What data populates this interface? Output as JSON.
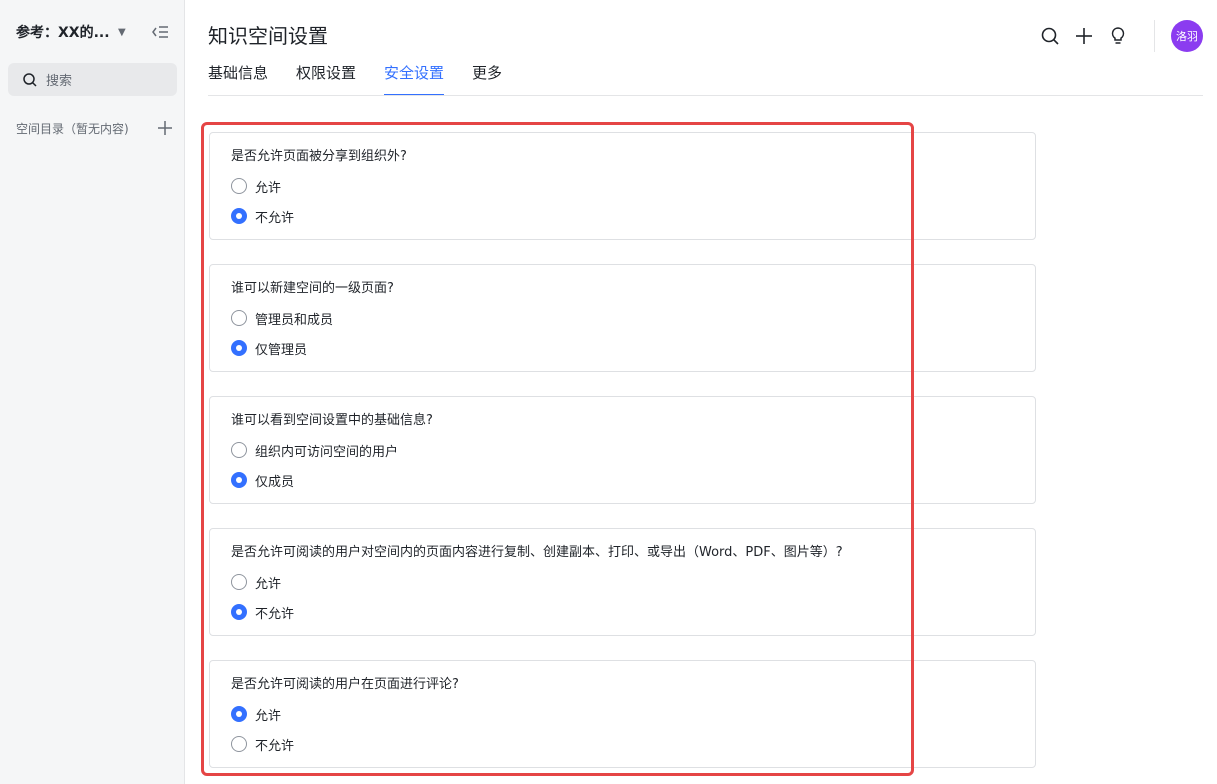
{
  "sidebar": {
    "space_name": "参考：XX的...",
    "search_placeholder": "搜索",
    "directory_label": "空间目录（暂无内容)"
  },
  "header": {
    "title": "知识空间设置",
    "avatar_text": "洛羽"
  },
  "tabs": [
    {
      "label": "基础信息",
      "active": false
    },
    {
      "label": "权限设置",
      "active": false
    },
    {
      "label": "安全设置",
      "active": true
    },
    {
      "label": "更多",
      "active": false
    }
  ],
  "settings": [
    {
      "question": "是否允许页面被分享到组织外?",
      "options": [
        {
          "label": "允许",
          "checked": false
        },
        {
          "label": "不允许",
          "checked": true
        }
      ]
    },
    {
      "question": "谁可以新建空间的一级页面?",
      "options": [
        {
          "label": "管理员和成员",
          "checked": false
        },
        {
          "label": "仅管理员",
          "checked": true
        }
      ]
    },
    {
      "question": "谁可以看到空间设置中的基础信息?",
      "options": [
        {
          "label": "组织内可访问空间的用户",
          "checked": false
        },
        {
          "label": "仅成员",
          "checked": true
        }
      ]
    },
    {
      "question": "是否允许可阅读的用户对空间内的页面内容进行复制、创建副本、打印、或导出（Word、PDF、图片等）?",
      "options": [
        {
          "label": "允许",
          "checked": false
        },
        {
          "label": "不允许",
          "checked": true
        }
      ]
    },
    {
      "question": "是否允许可阅读的用户在页面进行评论?",
      "options": [
        {
          "label": "允许",
          "checked": true
        },
        {
          "label": "不允许",
          "checked": false
        }
      ]
    }
  ],
  "colors": {
    "accent": "#3370ff",
    "highlight": "#e54545",
    "avatar": "#8b3cf0"
  }
}
